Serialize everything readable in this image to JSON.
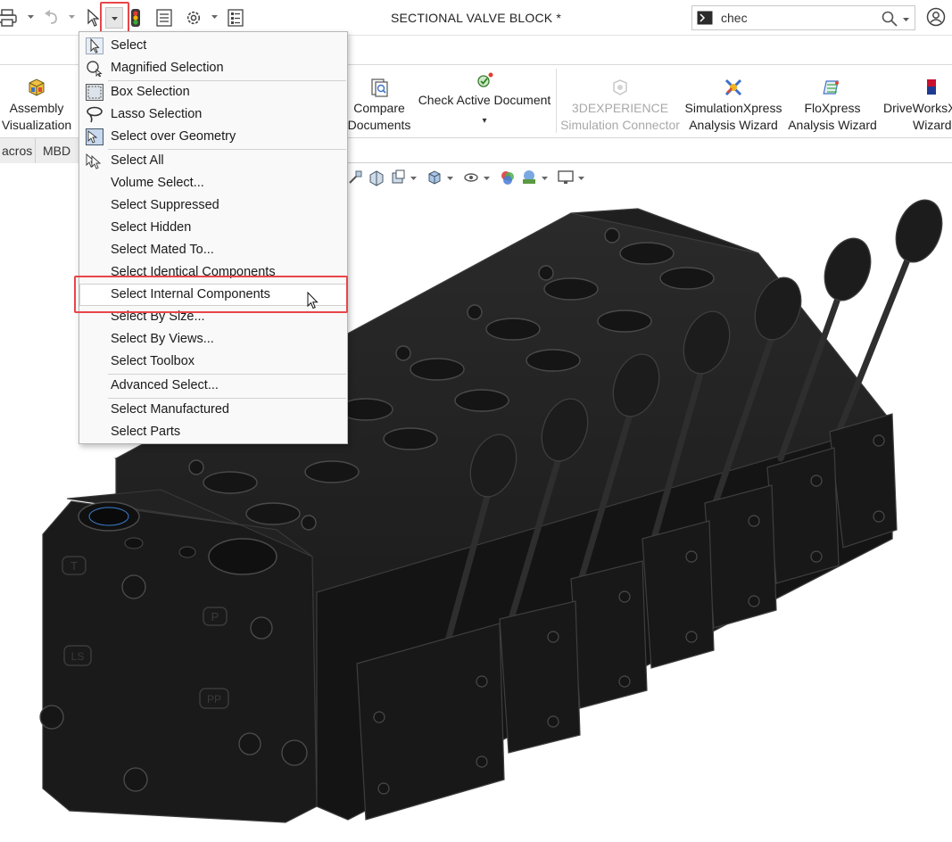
{
  "window": {
    "title": "SECTIONAL VALVE BLOCK *"
  },
  "search": {
    "value": "chec"
  },
  "ribbon": {
    "tools": [
      {
        "line1": "Assembly",
        "line2": "Visualization",
        "icon": "assembly-visualization-icon",
        "disabled": false
      },
      {
        "line1": "Compare",
        "line2": "Documents",
        "icon": "compare-documents-icon",
        "disabled": false
      },
      {
        "line1": "Check Active Document",
        "line2": "",
        "icon": "check-active-document-icon",
        "disabled": false
      },
      {
        "line1": "3DEXPERIENCE",
        "line2": "Simulation Connector",
        "icon": "3dexperience-icon",
        "disabled": true
      },
      {
        "line1": "SimulationXpress",
        "line2": "Analysis Wizard",
        "icon": "simulationxpress-icon",
        "disabled": false
      },
      {
        "line1": "FloXpress",
        "line2": "Analysis Wizard",
        "icon": "floxpress-icon",
        "disabled": false
      },
      {
        "line1": "DriveWorksX",
        "line2": "Wizard",
        "icon": "driveworksxpress-icon",
        "disabled": false
      }
    ]
  },
  "tabs": [
    {
      "label": "acros"
    },
    {
      "label": "MBD"
    }
  ],
  "select_menu": {
    "items": [
      {
        "label": "Select",
        "icon": "arrow-cursor-icon"
      },
      {
        "label": "Magnified Selection",
        "icon": "magnified-selection-icon"
      },
      {
        "label": "Box Selection",
        "icon": "box-selection-icon"
      },
      {
        "label": "Lasso Selection",
        "icon": "lasso-icon"
      },
      {
        "label": "Select over Geometry",
        "icon": "select-over-geometry-icon"
      },
      {
        "label": "Select All",
        "icon": "select-all-icon"
      },
      {
        "label": "Volume Select...",
        "icon": ""
      },
      {
        "label": "Select Suppressed",
        "icon": ""
      },
      {
        "label": "Select Hidden",
        "icon": ""
      },
      {
        "label": "Select Mated To...",
        "icon": ""
      },
      {
        "label": "Select Identical Components",
        "icon": ""
      },
      {
        "label": "Select Internal Components",
        "icon": ""
      },
      {
        "label": "Select By Size...",
        "icon": ""
      },
      {
        "label": "Select By Views...",
        "icon": ""
      },
      {
        "label": "Select Toolbox",
        "icon": ""
      },
      {
        "label": "Advanced Select...",
        "icon": ""
      },
      {
        "label": "Select Manufactured",
        "icon": ""
      },
      {
        "label": "Select Parts",
        "icon": ""
      }
    ],
    "highlighted": "Select Internal Components"
  },
  "model_labels": {
    "port_t": "T",
    "port_p": "P",
    "port_ls": "LS",
    "port_pp": "PP"
  },
  "colors": {
    "highlight_box": "#e8454a",
    "model_body": "#1b1b1b"
  }
}
